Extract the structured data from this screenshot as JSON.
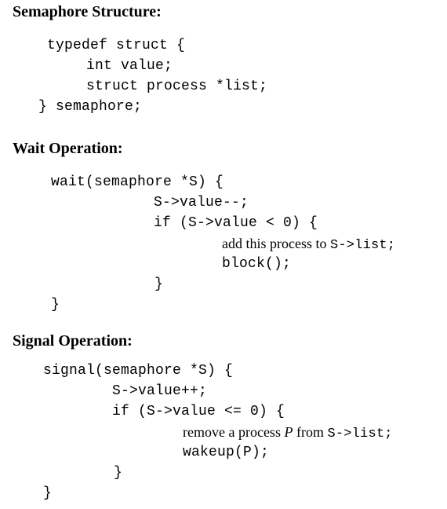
{
  "document": {
    "title": "Semaphore Structure / Wait / Signal pseudocode",
    "background_color": "#ffffff",
    "text_color": "#000000"
  },
  "sections": [
    {
      "id": "semaphore-structure",
      "heading": "Semaphore Structure:",
      "lines": [
        "typedef struct {",
        "    int value;",
        "    struct process *list;",
        "} semaphore;"
      ]
    },
    {
      "id": "wait-operation",
      "heading": "Wait Operation:",
      "lines": [
        "wait(semaphore *S) {",
        "S->value--;",
        "if (S->value < 0) {",
        "block();",
        "}",
        "}"
      ],
      "mixed_line": {
        "prose_part": "add this process to ",
        "code_part": "S->list;"
      }
    },
    {
      "id": "signal-operation",
      "heading": "Signal Operation:",
      "lines": [
        "signal(semaphore *S) {",
        "S->value++;",
        "if (S->value <= 0) {",
        "wakeup(P);",
        "}",
        "}"
      ],
      "mixed_line": {
        "prose_part_1": "remove a process ",
        "italic_var": "P",
        "prose_part_2": " from ",
        "code_part": "S->list;"
      }
    }
  ],
  "lines": {
    "struct_heading": "Semaphore Structure:",
    "struct_l1": "typedef struct {",
    "struct_l2": "int value;",
    "struct_l3": "struct process *list;",
    "struct_l4": "} semaphore;",
    "wait_heading": "Wait Operation:",
    "wait_l1": "wait(semaphore *S) {",
    "wait_l2": "S->value--;",
    "wait_l3": "if (S->value < 0) {",
    "wait_l4_prose": "add this process to ",
    "wait_l4_code": "S->list;",
    "wait_l5": "block();",
    "wait_l6": "}",
    "wait_l7": "}",
    "signal_heading": "Signal Operation:",
    "signal_l1": "signal(semaphore *S) {",
    "signal_l2": "S->value++;",
    "signal_l3": "if (S->value <= 0) {",
    "signal_l4_prose_a": "remove a process ",
    "signal_l4_italic": "P",
    "signal_l4_prose_b": " from ",
    "signal_l4_code": "S->list;",
    "signal_l5": "wakeup(P);",
    "signal_l6": "}",
    "signal_l7": "}"
  }
}
